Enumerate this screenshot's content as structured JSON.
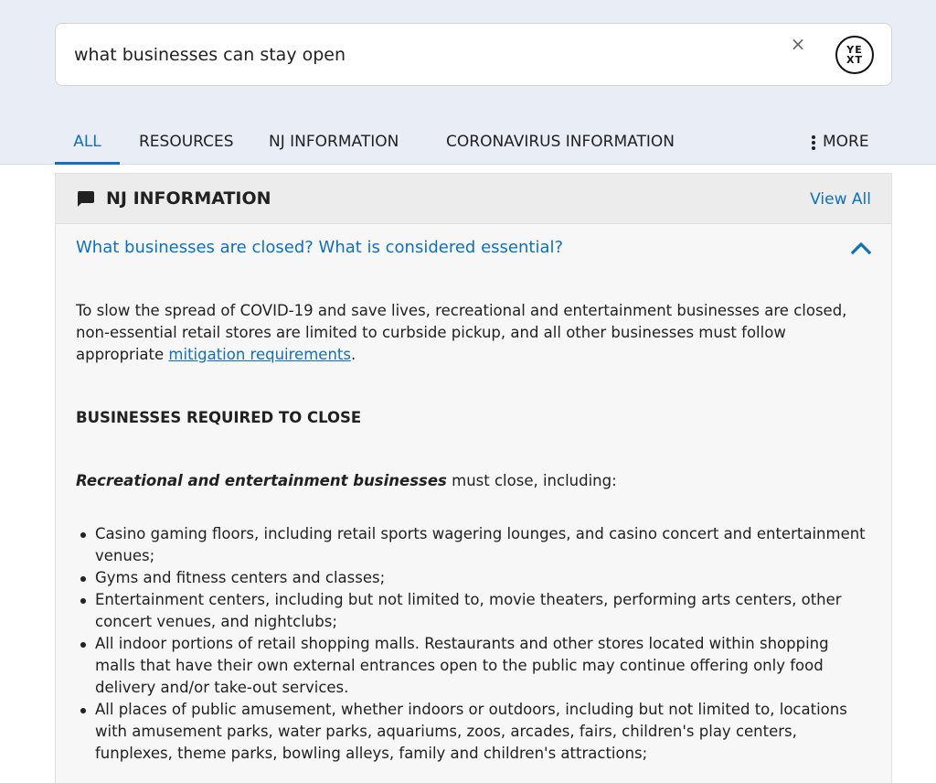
{
  "search": {
    "query": "what businesses can stay open",
    "clear_icon": "×",
    "logo_top": "YE",
    "logo_bottom": "XT"
  },
  "tabs": [
    {
      "label": "ALL",
      "active": true
    },
    {
      "label": "RESOURCES",
      "active": false
    },
    {
      "label": "NJ INFORMATION",
      "active": false
    },
    {
      "label": "CORONAVIRUS INFORMATION",
      "active": false
    },
    {
      "label": "MORE",
      "active": false
    }
  ],
  "section": {
    "icon": "chat-bubble-icon",
    "title": "NJ INFORMATION",
    "view_all": "View All",
    "question": "What businesses are closed? What is considered essential?",
    "chevron_icon": "chevron-up-icon",
    "intro": "To slow the spread of COVID-19 and save lives, recreational and entertainment businesses are closed, non-essential retail stores are limited to curbside pickup, and all other businesses must follow appropriate ",
    "intro_link": "mitigation requirements",
    "intro_end": ".",
    "heading": "BUSINESSES REQUIRED TO CLOSE",
    "lead_emphasis": "Recreational and entertainment businesses",
    "lead_rest": " must close, including:",
    "bullets": [
      "Casino gaming floors, including retail sports wagering lounges, and casino concert and entertainment venues;",
      "Gyms and fitness centers and classes;",
      "Entertainment centers, including but not limited to, movie theaters, performing arts centers, other concert venues, and nightclubs;",
      "All indoor portions of retail shopping malls. Restaurants and other stores located within shopping malls that have their own external entrances open to the public may continue offering only food delivery and/or take-out services.",
      "All places of public amusement, whether indoors or outdoors, including but not limited to, locations with amusement parks, water parks, aquariums, zoos, arcades, fairs, children's play centers, funplexes, theme parks, bowling alleys, family and children's attractions;"
    ]
  },
  "colors": {
    "accent": "#0f70c0",
    "top_band": "#e9edf5",
    "section_bg": "#f7f7f7",
    "header_bg": "#ececec"
  }
}
